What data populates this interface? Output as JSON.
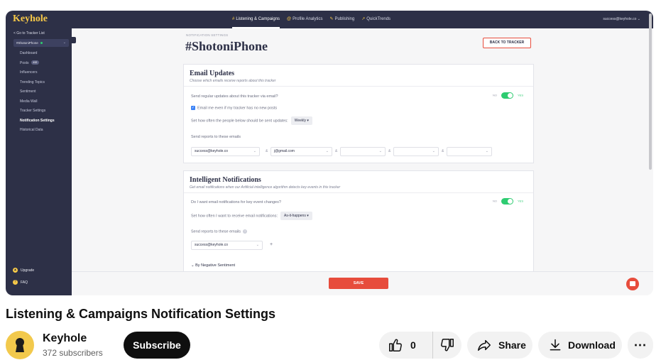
{
  "app": {
    "logo": "Keyhole",
    "back_link": "<  Go to Tracker List",
    "tracker_select": "#ShotoniPhone",
    "nav": [
      {
        "label": "Dashboard"
      },
      {
        "label": "Posts",
        "badge": "492"
      },
      {
        "label": "Influencers"
      },
      {
        "label": "Trending Topics"
      },
      {
        "label": "Sentiment"
      },
      {
        "label": "Media Wall"
      },
      {
        "label": "Tracker Settings"
      },
      {
        "label": "Notification Settings",
        "active": true
      },
      {
        "label": "Historical Data"
      }
    ],
    "upgrade": "Upgrade",
    "faq": "FAQ",
    "tabs": [
      {
        "icon": "#",
        "label": "Listening & Campaigns",
        "active": true
      },
      {
        "icon": "@",
        "label": "Profile Analytics"
      },
      {
        "icon": "✎",
        "label": "Publishing"
      },
      {
        "icon": "↗",
        "label": "QuickTrends"
      }
    ],
    "account": "success@keyhole.co",
    "eyebrow": "NOTIFICATION SETTINGS",
    "page_title": "#ShotoniPhone",
    "back_button": "BACK TO TRACKER",
    "email_updates": {
      "title": "Email Updates",
      "subtitle": "Choose which emails receive reports about this tracker",
      "q1": "Send regular updates about this tracker via email?",
      "no": "NO",
      "yes": "YES",
      "checkbox": "Email me even if my tracker has no new posts",
      "freq_label": "Set how often the people below should be sent updates:",
      "freq_value": "Weekly ▾",
      "send_label": "Send reports to these emails",
      "emails": [
        "success@keyhole.co",
        "j@gmail.com",
        "",
        "",
        ""
      ],
      "amp": "&"
    },
    "intelligent": {
      "title": "Intelligent Notifications",
      "subtitle": "Get email notifications when our Artificial intelligence algorithm detects key events in this tracker",
      "q1": "Do I want email notifications for key event changes?",
      "no": "NO",
      "yes": "YES",
      "freq_label": "Set how often I want to receive email notifications:",
      "freq_value": "As-it-happens ▾",
      "send_label": "Send reports to these emails",
      "email": "success@keyhole.co",
      "plus": "+",
      "collapsed": "By Negative Sentiment"
    },
    "save": "SAVE"
  },
  "video": {
    "title": "Listening & Campaigns Notification Settings",
    "channel": "Keyhole",
    "subscribers": "372 subscribers",
    "subscribe": "Subscribe",
    "likes": "0",
    "share": "Share",
    "download": "Download",
    "more": "⋯"
  }
}
